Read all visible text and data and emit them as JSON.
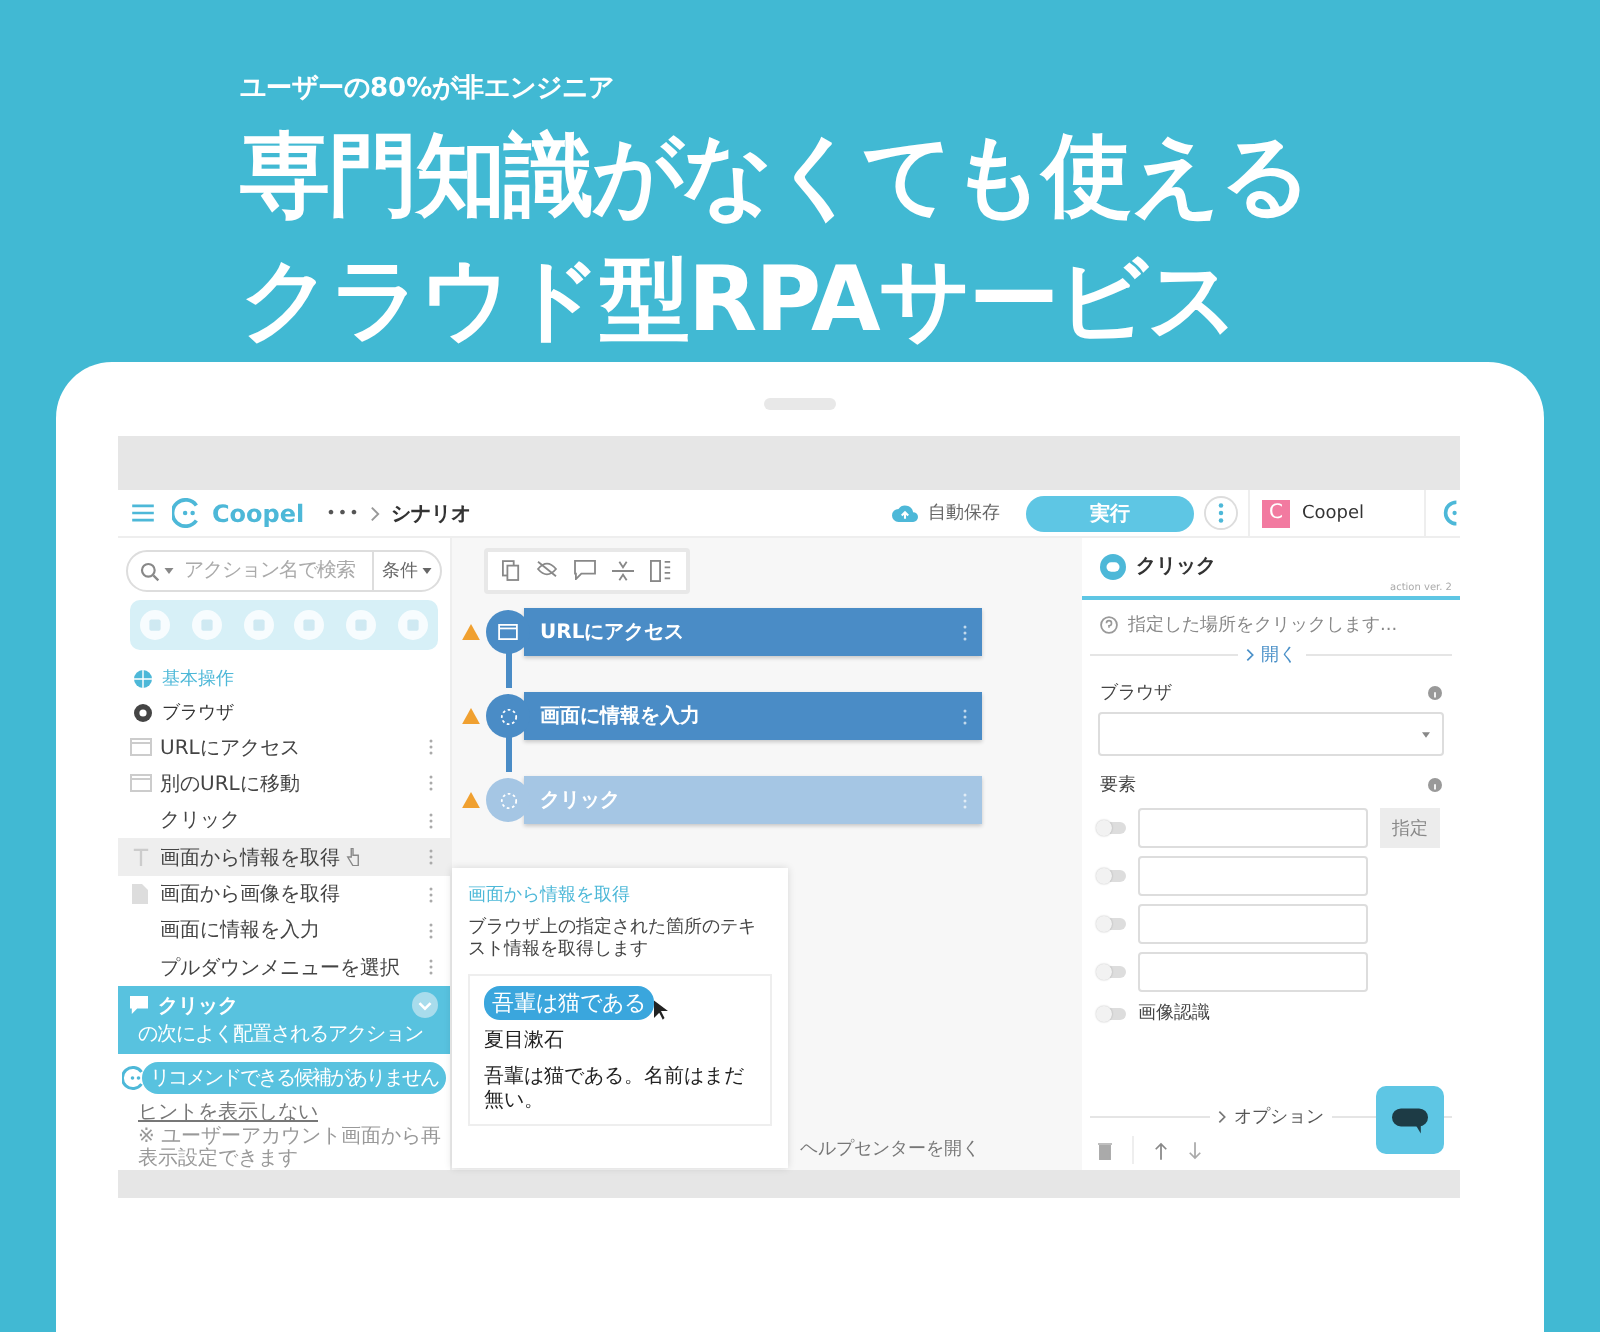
{
  "promo": {
    "tagline": "ユーザーの80%が非エンジニア",
    "headline": [
      "専門知識がなくても使える",
      "クラウド型RPAサービス"
    ]
  },
  "app": {
    "header": {
      "logo": "Coopel",
      "more": "•••",
      "breadcrumb": "シナリオ",
      "autosave": "自動保存",
      "run_button": "実行",
      "workspace": {
        "initial": "C",
        "name": "Coopel"
      }
    },
    "sidebar": {
      "search_placeholder": "アクション名で検索",
      "filter": "条件",
      "category": "基本操作",
      "group": "ブラウザ",
      "items": [
        {
          "label": "URLにアクセス",
          "kind": "window",
          "selected": false
        },
        {
          "label": "別のURLに移動",
          "kind": "window",
          "selected": false
        },
        {
          "label": "クリック",
          "kind": "plain",
          "selected": false
        },
        {
          "label": "画面から情報を取得",
          "kind": "text",
          "selected": true
        },
        {
          "label": "画面から画像を取得",
          "kind": "doc",
          "selected": false
        },
        {
          "label": "画面に情報を入力",
          "kind": "plain",
          "selected": false
        },
        {
          "label": "プルダウンメニューを選択",
          "kind": "plain",
          "selected": false
        }
      ],
      "hint": {
        "title": "クリック",
        "subtitle": "の次によく配置されるアクション"
      },
      "recommend": "リコメンドできる候補がありません",
      "hide_link": "ヒントを表示しない",
      "note": "※ ユーザーアカウント画面から再表示設定できます"
    },
    "canvas": {
      "nodes": [
        {
          "label": "URLにアクセス",
          "kind": "browser",
          "selected": false
        },
        {
          "label": "画面に情報を入力",
          "kind": "action",
          "selected": false
        },
        {
          "label": "クリック",
          "kind": "action",
          "selected": true
        }
      ],
      "popup": {
        "title": "画面から情報を取得",
        "description": "ブラウザ上の指定された箇所のテキスト情報を取得します",
        "sample_title": "吾輩は猫である",
        "sample_author": "夏目漱石",
        "sample_text": "吾輩は猫である。名前はまだ無い。"
      },
      "help_link": "ヘルプセンターを開く"
    },
    "panel": {
      "title": "クリック",
      "version": "action ver. 2",
      "description": "指定した場所をクリックします...",
      "expand": "開く",
      "browser_label": "ブラウザ",
      "element_label": "要素",
      "pick_button": "指定",
      "element_rows": [
        {
          "on": false
        },
        {
          "on": false
        },
        {
          "on": false
        },
        {
          "on": false
        }
      ],
      "image_recognition": {
        "label": "画像認識",
        "on": false
      },
      "options": "オプション"
    }
  }
}
